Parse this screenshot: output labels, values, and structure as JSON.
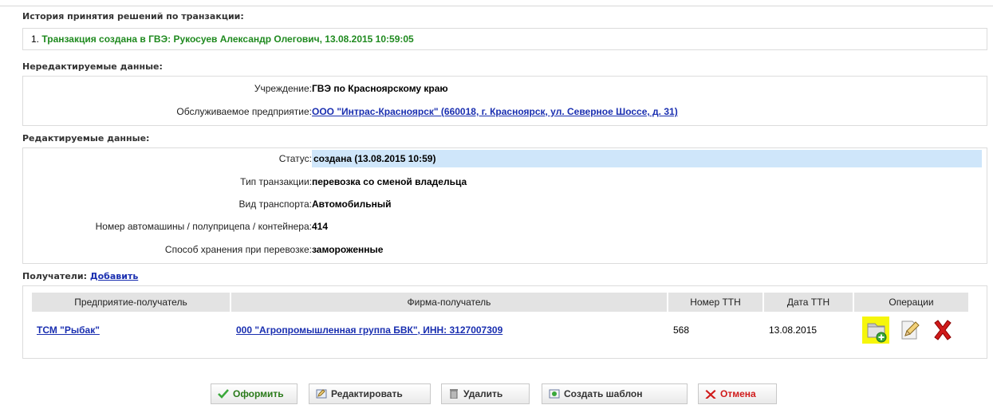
{
  "history": {
    "title": "История принятия решений по транзакции:",
    "items": [
      {
        "num": "1.",
        "text": "Транзакция создана в ГВЭ: Рукосуев Александр Олегович, 13.08.2015 10:59:05"
      }
    ]
  },
  "readonly": {
    "title": "Нередактируемые данные:",
    "institution_label": "Учреждение:",
    "institution_value": "ГВЭ по Красноярскому краю",
    "enterprise_label": "Обслуживаемое предприятие:",
    "enterprise_value": "ООО \"Интрас-Красноярск\" (660018, г. Красноярск, ул. Северное Шоссе, д. 31)"
  },
  "editable": {
    "title": "Редактируемые данные:",
    "status_label": "Статус:",
    "status_value": "создана (13.08.2015 10:59)",
    "type_label": "Тип транзакции:",
    "type_value": "перевозка со сменой владельца",
    "transport_label": "Вид транспорта:",
    "transport_value": "Автомобильный",
    "vehicle_label": "Номер автомашины / полуприцепа / контейнера:",
    "vehicle_value": "414",
    "storage_label": "Способ хранения при перевозке:",
    "storage_value": "замороженные"
  },
  "recipients": {
    "title": "Получатели:",
    "add_link": "Добавить",
    "columns": [
      "Предприятие-получатель",
      "Фирма-получатель",
      "Номер ТТН",
      "Дата ТТН",
      "Операции"
    ],
    "rows": [
      {
        "enterprise": "ТСМ \"Рыбак\"",
        "firm": "000 \"Агропромышленная группа БВК\", ИНН: 3127007309",
        "ttn_number": "568",
        "ttn_date": "13.08.2015"
      }
    ]
  },
  "buttons": {
    "submit": "Оформить",
    "edit": "Редактировать",
    "delete": "Удалить",
    "template": "Создать шаблон",
    "cancel": "Отмена"
  },
  "colors": {
    "accent_link": "#1a2fb0",
    "history_green": "#1f8a1f",
    "status_highlight": "#cfe6fa",
    "cancel_red": "#d01a1a",
    "highlight_yellow": "#f6f60a"
  }
}
